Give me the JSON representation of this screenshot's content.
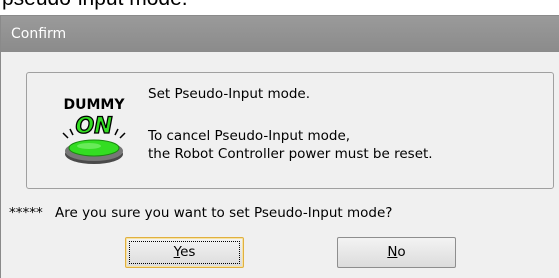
{
  "caption_top": "pseudo-input mode.",
  "dialog": {
    "title": "Confirm",
    "icon": {
      "name": "dummy-on-icon",
      "text_top": "DUMMY",
      "text_mid": "ON",
      "colors": {
        "lamp": "#33dd22",
        "ring": "#555555",
        "text": "#000000"
      }
    },
    "message": {
      "line1": "Set Pseudo-Input mode.",
      "line2": "To cancel Pseudo-Input mode,",
      "line3": "the Robot Controller power must be reset."
    },
    "question": {
      "prefix": "*****",
      "text": "Are you sure you want to set Pseudo-Input mode?"
    },
    "buttons": {
      "yes": {
        "mnemonic": "Y",
        "rest": "es",
        "focused": true
      },
      "no": {
        "mnemonic": "N",
        "rest": "o"
      }
    }
  },
  "colors": {
    "titlebar": "#8f8f8f",
    "dialog_bg": "#f0f0f0",
    "focus_border": "#e0b040"
  }
}
